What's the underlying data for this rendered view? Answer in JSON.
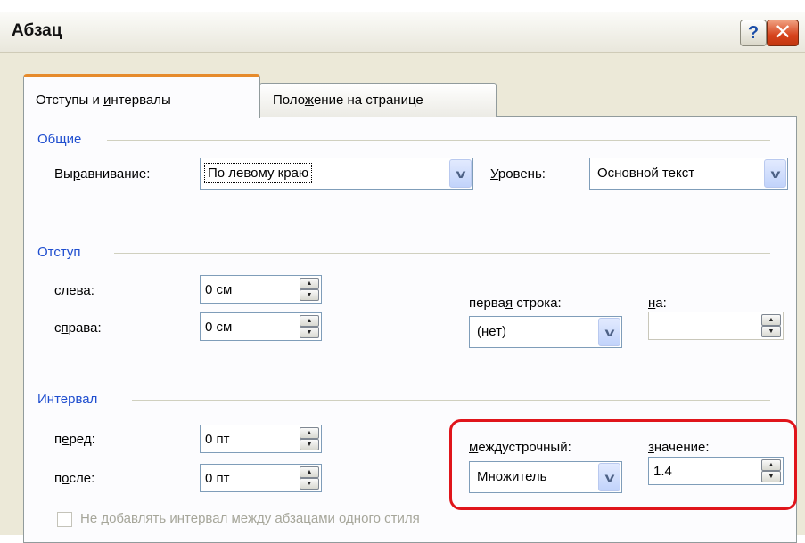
{
  "window": {
    "title": "Абзац",
    "help_label": "?",
    "close_label": "✕"
  },
  "tabs": [
    {
      "label_pre": "Отступы и ",
      "label_u": "и",
      "label_post": "нтервалы",
      "active": true
    },
    {
      "label_pre": "Поло",
      "label_u": "ж",
      "label_post": "ение на странице",
      "active": false
    }
  ],
  "general": {
    "section_label": "Общие",
    "alignment_label_pre": "Вы",
    "alignment_label_u": "р",
    "alignment_label_post": "авнивание:",
    "alignment_value": "По левому краю",
    "level_label_pre": "",
    "level_label_u": "У",
    "level_label_post": "ровень:",
    "level_value": "Основной текст"
  },
  "indent": {
    "section_label": "Отступ",
    "left_label_pre": "с",
    "left_label_u": "л",
    "left_label_post": "ева:",
    "left_value": "0 см",
    "right_label_pre": "с",
    "right_label_u": "п",
    "right_label_post": "рава:",
    "right_value": "0 см",
    "first_line_label_pre": "перва",
    "first_line_label_u": "я",
    "first_line_label_post": " строка:",
    "first_line_value": "(нет)",
    "by_label_pre": "",
    "by_label_u": "н",
    "by_label_post": "а:",
    "by_value": ""
  },
  "spacing": {
    "section_label": "Интервал",
    "before_label_pre": "п",
    "before_label_u": "е",
    "before_label_post": "ред:",
    "before_value": "0 пт",
    "after_label_pre": "п",
    "after_label_u": "о",
    "after_label_post": "сле:",
    "after_value": "0 пт",
    "line_spacing_label_pre": "",
    "line_spacing_label_u": "м",
    "line_spacing_label_post": "еждустрочный:",
    "line_spacing_value": "Множитель",
    "value_label_pre": "",
    "value_label_u": "з",
    "value_label_post": "начение:",
    "value_value": "1.4",
    "dont_add_label": "Не добавлять интервал между абзацами одного стиля",
    "dont_add_checked": false
  },
  "colors": {
    "section_text": "#1f4ecf",
    "highlight": "#e0151b",
    "tab_accent": "#e68b2c"
  }
}
